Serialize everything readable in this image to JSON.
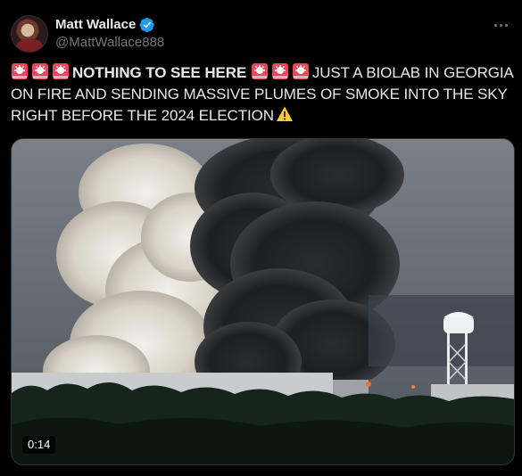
{
  "author": {
    "display_name": "Matt Wallace",
    "handle": "@MattWallace888",
    "verified": true,
    "verified_color": "#1d9bf0"
  },
  "post": {
    "bold_text": "NOTHING TO SEE HERE",
    "body_text": "JUST A BIOLAB IN GEORGIA ON FIRE AND SENDING MASSIVE PLUMES OF SMOKE INTO THE SKY RIGHT BEFORE THE 2024 ELECTION",
    "leading_emoji": "siren-icon",
    "trailing_emoji": "warning-icon"
  },
  "media": {
    "type": "video",
    "duration": "0:14"
  },
  "icons": {
    "more": "more-options-icon",
    "verified": "verified-badge-icon"
  },
  "colors": {
    "background": "#000000",
    "text": "#e7e9ea",
    "secondary_text": "#71767b",
    "border": "#2f3336"
  }
}
